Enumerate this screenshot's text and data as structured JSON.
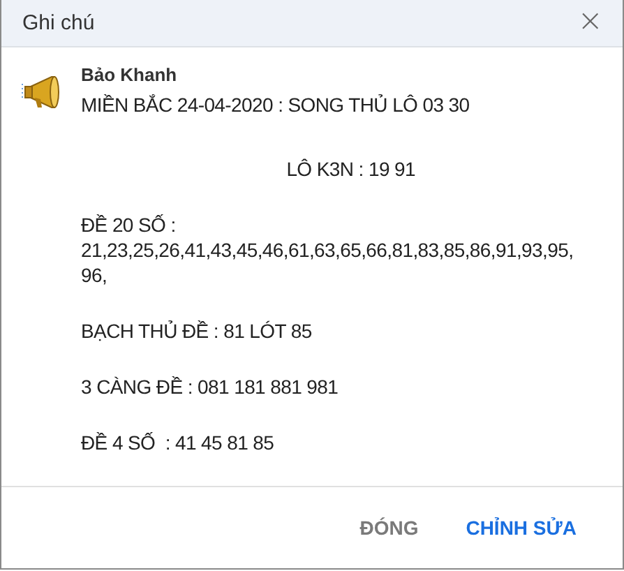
{
  "window": {
    "title": "Ghi chú",
    "close": "×"
  },
  "note": {
    "author": "Bảo Khanh",
    "paragraphs": [
      "MIỀN BẮC 24-04-2020 : SONG THỦ LÔ 03 30",
      "                                         LÔ K3N : 19 91",
      "ĐỀ 20 SỐ : 21,23,25,26,41,43,45,46,61,63,65,66,81,83,85,86,91,93,95, 96,",
      "BẠCH THỦ ĐỀ : 81 LÓT 85",
      "3 CÀNG ĐỀ : 081 181 881 981",
      "ĐỀ 4 SỐ  : 41 45 81 85"
    ]
  },
  "buttons": [
    {
      "label": "ĐÓNG",
      "kind": "secondary"
    },
    {
      "label": "CHỈNH SỬA",
      "kind": "primary"
    }
  ]
}
